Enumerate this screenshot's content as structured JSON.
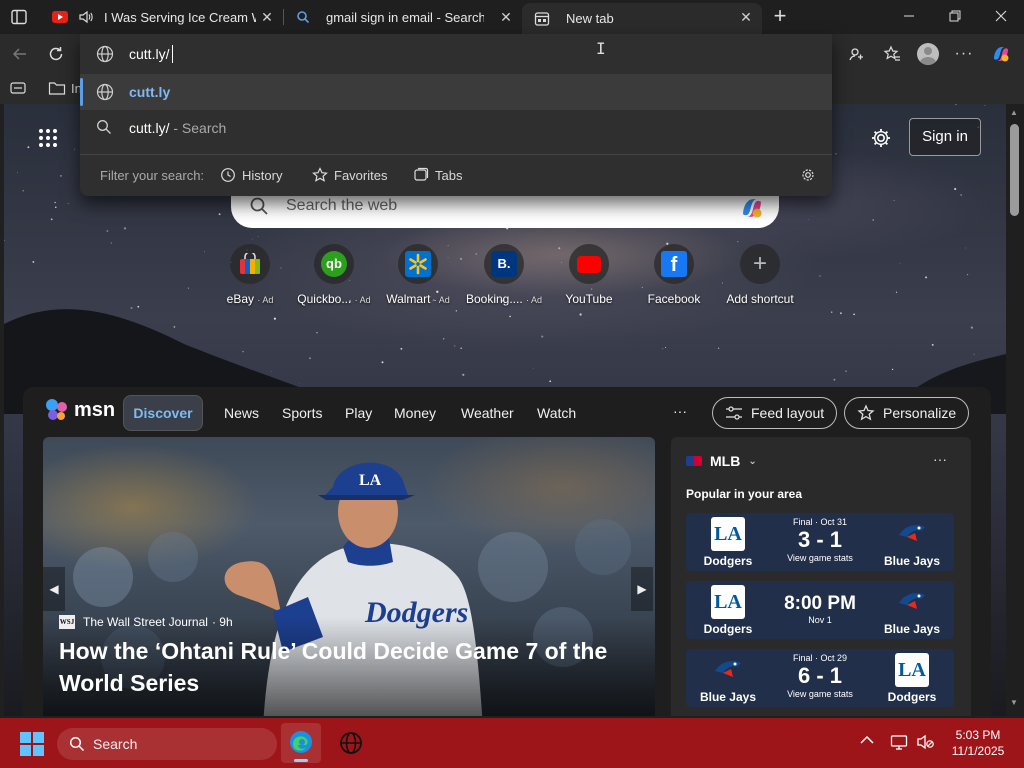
{
  "tabs": [
    {
      "title": "I Was Serving Ice Cream With",
      "favicon": "youtube-icon",
      "audio": true
    },
    {
      "title": "gmail sign in email - Search",
      "favicon": "search-icon"
    },
    {
      "title": "New tab",
      "favicon": "newtab-icon",
      "active": true
    }
  ],
  "omnibox": {
    "value": "cutt.ly/",
    "suggestions": [
      {
        "text": "cutt.ly",
        "icon": "globe-icon",
        "selected": true
      },
      {
        "text": "cutt.ly/",
        "suffix": " - Search",
        "icon": "search-icon"
      }
    ],
    "filter_label": "Filter your search:",
    "filters": [
      "History",
      "Favorites",
      "Tabs"
    ]
  },
  "newtab": {
    "search_placeholder": "Search the web",
    "sign_in": "Sign in",
    "shortcuts": [
      {
        "label": "eBay",
        "ad": "· Ad",
        "icon": "ebay-icon"
      },
      {
        "label": "Quickbo...",
        "ad": "· Ad",
        "icon": "quickbooks-icon"
      },
      {
        "label": "Walmart",
        "ad": "· Ad",
        "icon": "walmart-icon"
      },
      {
        "label": "Booking....",
        "ad": "· Ad",
        "icon": "booking-icon"
      },
      {
        "label": "YouTube",
        "ad": "",
        "icon": "youtube-icon"
      },
      {
        "label": "Facebook",
        "ad": "",
        "icon": "facebook-icon"
      },
      {
        "label": "Add shortcut",
        "ad": "",
        "icon": "plus-icon"
      }
    ]
  },
  "msn": {
    "brand": "msn",
    "nav": [
      "Discover",
      "News",
      "Sports",
      "Play",
      "Money",
      "Weather",
      "Watch"
    ],
    "more": "···",
    "feed_layout": "Feed layout",
    "personalize": "Personalize",
    "hero": {
      "source": "The Wall Street Journal",
      "age": "· 9h",
      "headline": "How the ‘Ohtani Rule’ Could Decide Game 7 of the World Series"
    },
    "mlb": {
      "title": "MLB",
      "subtitle": "Popular in your area",
      "games": [
        {
          "home": "Dodgers",
          "away": "Blue Jays",
          "status": "Final · Oct 31",
          "score": "3 - 1",
          "link": "View game stats"
        },
        {
          "home": "Dodgers",
          "away": "Blue Jays",
          "status": "",
          "score": "8:00 PM",
          "date": "Nov 1",
          "link": ""
        },
        {
          "home": "Blue Jays",
          "away": "Dodgers",
          "status": "Final · Oct 29",
          "score": "6 - 1",
          "link": "View game stats"
        }
      ]
    }
  },
  "taskbar": {
    "search": "Search",
    "time": "5:03 PM",
    "date": "11/1/2025"
  },
  "colors": {
    "accent": "#5c9fe6",
    "taskbar": "#9e1519",
    "mlb_card": "#212f4a"
  }
}
